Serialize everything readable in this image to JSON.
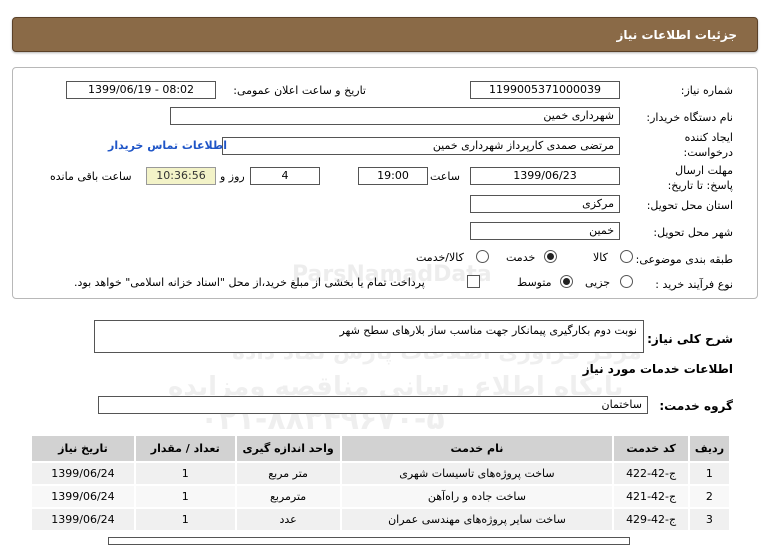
{
  "header": {
    "title": "جزئیات اطلاعات نیاز"
  },
  "form": {
    "need_number_label": "شماره نیاز:",
    "need_number": "1199005371000039",
    "announce_label": "تاریخ و ساعت اعلان عمومی:",
    "announce_value": "1399/06/19 - 08:02",
    "buyer_label": "نام دستگاه خریدار:",
    "buyer_value": "شهرداری خمین",
    "creator_label": "ایجاد کننده درخواست:",
    "creator_value": "مرتضی صمدی کارپرداز شهرداری خمین",
    "contact_link": "اطلاعات تماس خریدار",
    "deadline_label": "مهلت ارسال پاسخ: تا تاریخ:",
    "deadline_date": "1399/06/23",
    "time_label": "ساعت",
    "deadline_time": "19:00",
    "days_value": "4",
    "days_label": "روز و",
    "remaining_time": "10:36:56",
    "remaining_label": "ساعت باقی مانده",
    "province_label": "استان محل تحویل:",
    "province_value": "مرکزی",
    "city_label": "شهر محل تحویل:",
    "city_value": "خمین",
    "category_label": "طبقه بندی موضوعی:",
    "category_options": [
      "کالا",
      "خدمت",
      "کالا/خدمت"
    ],
    "category_selected": "خدمت",
    "process_label": "نوع فرآیند خرید :",
    "process_options": [
      "جزیی",
      "متوسط"
    ],
    "process_selected": "متوسط",
    "payment_note": "پرداخت تمام یا بخشی از مبلغ خرید،از محل \"اسناد خزانه اسلامی\" خواهد بود."
  },
  "description": {
    "label": "شرح کلی نیاز:",
    "value": "نوبت دوم بکارگیری پیمانکار جهت مناسب ساز بلارهای سطح شهر"
  },
  "services": {
    "section_title": "اطلاعات خدمات مورد نیاز",
    "group_label": "گروه خدمت:",
    "group_value": "ساختمان",
    "columns": [
      "ردیف",
      "کد خدمت",
      "نام خدمت",
      "واحد اندازه گیری",
      "تعداد / مقدار",
      "تاریخ نیاز"
    ],
    "rows": [
      [
        "1",
        "ج-42-422",
        "ساخت پروژه‌های تاسیسات شهری",
        "متر مربع",
        "1",
        "1399/06/24"
      ],
      [
        "2",
        "ج-42-421",
        "ساخت جاده و راه‌آهن",
        "مترمربع",
        "1",
        "1399/06/24"
      ],
      [
        "3",
        "ج-42-429",
        "ساخت سایر پروژه‌های مهندسی عمران",
        "عدد",
        "1",
        "1399/06/24"
      ]
    ]
  },
  "watermark": {
    "line1": "ParsNamadData",
    "line2": "مرکز فراوری اطلاعات پارس نماد داده",
    "line3": "پایگاه اطلاع رسانی مناقصه ومزایده",
    "line4": "۰۲۱-۸۸۳۴۹۶۷۰-۵"
  }
}
